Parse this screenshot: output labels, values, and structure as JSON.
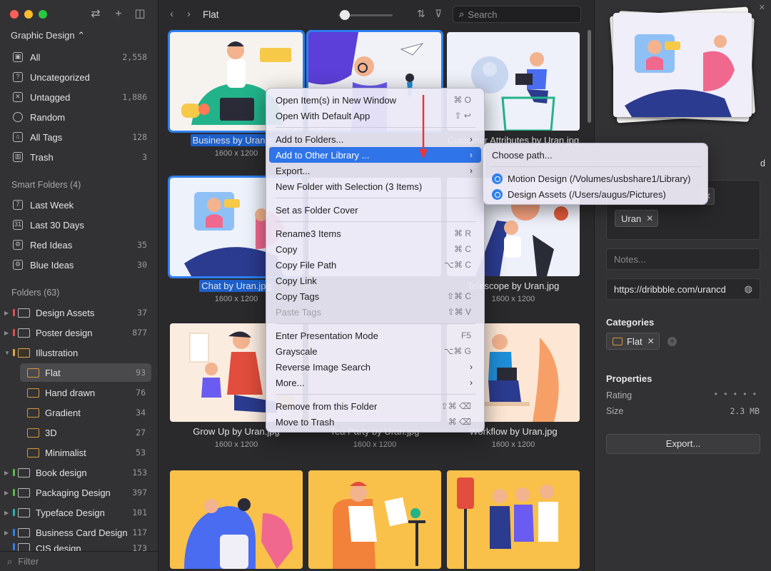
{
  "sidebar": {
    "library_title": "Graphic Design ⌃",
    "top_items": [
      {
        "label": "All",
        "count": "2,558"
      },
      {
        "label": "Uncategorized",
        "count": ""
      },
      {
        "label": "Untagged",
        "count": "1,886"
      },
      {
        "label": "Random",
        "count": ""
      },
      {
        "label": "All Tags",
        "count": "128"
      },
      {
        "label": "Trash",
        "count": "3"
      }
    ],
    "smart_title": "Smart Folders (4)",
    "smart_items": [
      {
        "label": "Last Week",
        "count": ""
      },
      {
        "label": "Last 30 Days",
        "count": ""
      },
      {
        "label": "Red Ideas",
        "count": "35"
      },
      {
        "label": "Blue Ideas",
        "count": "30"
      }
    ],
    "folders_title": "Folders (63)",
    "folders": [
      {
        "label": "Design Assets",
        "count": "37",
        "color": "#e04e4e"
      },
      {
        "label": "Poster design",
        "count": "877",
        "color": "#e04e4e"
      },
      {
        "label": "Illustration",
        "count": "",
        "color": "#e0a84a"
      },
      {
        "label": "Flat",
        "count": "93",
        "color": ""
      },
      {
        "label": "Hand drawn",
        "count": "76",
        "color": ""
      },
      {
        "label": "Gradient",
        "count": "34",
        "color": ""
      },
      {
        "label": "3D",
        "count": "27",
        "color": ""
      },
      {
        "label": "Minimalist",
        "count": "53",
        "color": ""
      },
      {
        "label": "Book design",
        "count": "153",
        "color": "#58b94a"
      },
      {
        "label": "Packaging Design",
        "count": "397",
        "color": "#58b94a"
      },
      {
        "label": "Typeface Design",
        "count": "101",
        "color": "#2ab2b9"
      },
      {
        "label": "Business Card Design",
        "count": "117",
        "color": "#2f80ed"
      },
      {
        "label": "CIS design",
        "count": "173",
        "color": "#2f80ed"
      }
    ],
    "filter_placeholder": "Filter"
  },
  "toolbar": {
    "breadcrumb": "Flat",
    "search_placeholder": "Search"
  },
  "grid": [
    {
      "caption": "Business by Uran.jpg",
      "dims": "1600 x 1200",
      "selected": true
    },
    {
      "caption": "",
      "dims": "",
      "selected": true
    },
    {
      "caption": "Customer Attributes by Uran.jpg",
      "dims": "",
      "selected": false
    },
    {
      "caption": "Chat by Uran.jpg",
      "dims": "1600 x 1200",
      "selected": true
    },
    {
      "caption": "",
      "dims": "",
      "selected": false
    },
    {
      "caption": "Telescope by Uran.jpg",
      "dims": "1600 x 1200",
      "selected": false
    },
    {
      "caption": "Grow Up by Uran.jpg",
      "dims": "1600 x 1200",
      "selected": false
    },
    {
      "caption": "Tea Party by Uran.jpg",
      "dims": "1600 x 1200",
      "selected": false
    },
    {
      "caption": "Workflow by Uran.jpg",
      "dims": "1600 x 1200",
      "selected": false
    }
  ],
  "context_menu": {
    "items": [
      {
        "label": "Open Item(s) in New Window",
        "shortcut": "⌘ O"
      },
      {
        "label": "Open With Default App",
        "shortcut": "⇧ ↩"
      },
      {
        "label": "Add to Folders...",
        "shortcut": "›"
      },
      {
        "label": "Add to Other Library ...",
        "shortcut": "›"
      },
      {
        "label": "Export...",
        "shortcut": "›"
      },
      {
        "label": "New Folder with Selection (3 Items)",
        "shortcut": ""
      },
      {
        "label": "Set as Folder Cover",
        "shortcut": ""
      },
      {
        "label": "Rename3 Items",
        "shortcut": "⌘ R"
      },
      {
        "label": "Copy",
        "shortcut": "⌘ C"
      },
      {
        "label": "Copy File Path",
        "shortcut": "⌥⌘ C"
      },
      {
        "label": "Copy Link",
        "shortcut": ""
      },
      {
        "label": "Copy Tags",
        "shortcut": "⇧⌘ C"
      },
      {
        "label": "Paste Tags",
        "shortcut": "⇧⌘ V"
      },
      {
        "label": "Enter Presentation Mode",
        "shortcut": "F5"
      },
      {
        "label": "Grayscale",
        "shortcut": "⌥⌘ G"
      },
      {
        "label": "Reverse Image Search",
        "shortcut": "›"
      },
      {
        "label": "More...",
        "shortcut": "›"
      },
      {
        "label": "Remove from this Folder",
        "shortcut": "⇧⌘ ⌫"
      },
      {
        "label": "Move to Trash",
        "shortcut": "⌘ ⌫"
      }
    ]
  },
  "submenu": {
    "choose": "Choose path...",
    "libraries": [
      {
        "label": "Motion Design (/Volumes/usbshare1/Library)"
      },
      {
        "label": "Design Assets (/Users/augus/Pictures)"
      }
    ]
  },
  "inspector": {
    "partial_label": "d",
    "tag_uran": "Uran",
    "notes_placeholder": "Notes...",
    "url": "https://dribbble.com/urancd",
    "categories_title": "Categories",
    "category_flat": "Flat",
    "properties_title": "Properties",
    "rating_label": "Rating",
    "rating_value": "• • • • •",
    "size_label": "Size",
    "size_value": "2.3 MB",
    "export_label": "Export..."
  },
  "colors": {
    "accent": "#2f74e8",
    "selection": "#2e7ff2"
  }
}
